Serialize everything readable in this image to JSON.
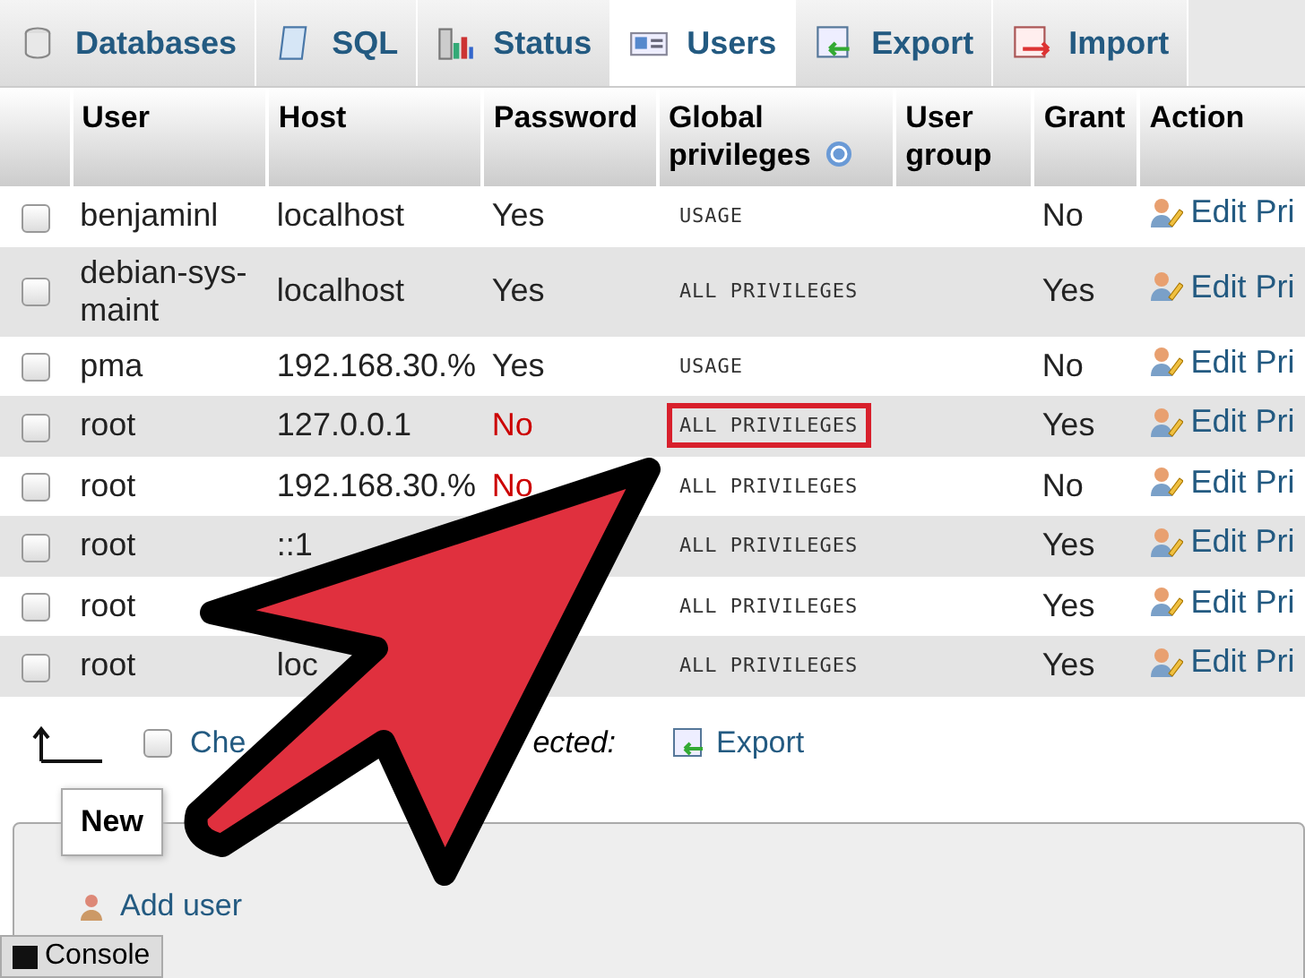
{
  "tabs": [
    {
      "label": "Databases",
      "selected": false
    },
    {
      "label": "SQL",
      "selected": false
    },
    {
      "label": "Status",
      "selected": false
    },
    {
      "label": "Users",
      "selected": true
    },
    {
      "label": "Export",
      "selected": false
    },
    {
      "label": "Import",
      "selected": false
    }
  ],
  "table": {
    "columns": [
      "User",
      "Host",
      "Password",
      "Global privileges",
      "User group",
      "Grant",
      "Action"
    ],
    "rows": [
      {
        "checked": false,
        "user": "benjaminl",
        "host": "localhost",
        "password": "Yes",
        "password_missing": false,
        "privileges": "USAGE",
        "highlighted": false,
        "grant": "No",
        "action": "Edit Pri"
      },
      {
        "checked": false,
        "user": "debian-sys-maint",
        "host": "localhost",
        "password": "Yes",
        "password_missing": false,
        "privileges": "ALL PRIVILEGES",
        "highlighted": false,
        "grant": "Yes",
        "action": "Edit Pri"
      },
      {
        "checked": false,
        "user": "pma",
        "host": "192.168.30.%",
        "password": "Yes",
        "password_missing": false,
        "privileges": "USAGE",
        "highlighted": false,
        "grant": "No",
        "action": "Edit Pri"
      },
      {
        "checked": false,
        "user": "root",
        "host": "127.0.0.1",
        "password": "No",
        "password_missing": true,
        "privileges": "ALL PRIVILEGES",
        "highlighted": true,
        "grant": "Yes",
        "action": "Edit Pri"
      },
      {
        "checked": false,
        "user": "root",
        "host": "192.168.30.%",
        "password": "No",
        "password_missing": true,
        "privileges": "ALL PRIVILEGES",
        "highlighted": false,
        "grant": "No",
        "action": "Edit Pri"
      },
      {
        "checked": false,
        "user": "root",
        "host": "::1",
        "privileges": "ALL PRIVILEGES",
        "highlighted": false,
        "grant": "Yes",
        "action": "Edit Pri"
      },
      {
        "checked": false,
        "user": "root",
        "privileges": "ALL PRIVILEGES",
        "highlighted": false,
        "grant": "Yes",
        "action": "Edit Pri"
      },
      {
        "checked": false,
        "user": "root",
        "host": "loc",
        "privileges": "ALL PRIVILEGES",
        "highlighted": false,
        "grant": "Yes",
        "action": "Edit Pri"
      }
    ]
  },
  "footer": {
    "check_all": {
      "label": "Che",
      "checked": false
    },
    "with_selected": "ected:",
    "export": "Export"
  },
  "new_section": {
    "legend": "New",
    "add_user": "Add user"
  },
  "console": "Console"
}
